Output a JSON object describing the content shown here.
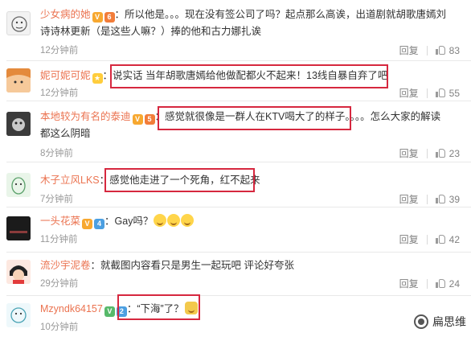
{
  "comments": [
    {
      "user": "少女病的她",
      "text": "：所以他是。。。现在没有签公司了吗？起点那么高诶，出道剧就胡歌唐嫣刘诗诗林更新（是这些人嘛？）捧的他和古力娜扎诶",
      "time": "12分钟前",
      "reply": "回复",
      "likes": "83"
    },
    {
      "user": "妮可妮可妮",
      "text": "：说实话 当年胡歌唐嫣给他做配都火不起来！13线自暴自弃了吧",
      "time": "12分钟前",
      "reply": "回复",
      "likes": "55"
    },
    {
      "user": "本地较为有名的泰迪",
      "text": "：感觉就很像是一群人在KTV喝大了的样子。。。。怎么大家的解读都这么阴暗",
      "time": "8分钟前",
      "reply": "回复",
      "likes": "23"
    },
    {
      "user": "木子立风LKS",
      "text": "：感觉他走进了一个死角，红不起来",
      "time": "7分钟前",
      "reply": "回复",
      "likes": "39"
    },
    {
      "user": "一头花菜",
      "text": "：Gay吗？",
      "time": "11分钟前",
      "reply": "回复",
      "likes": "42"
    },
    {
      "user": "流沙宇泥卷",
      "text": "：就截图内容看只是男生一起玩吧 评论好夸张",
      "time": "29分钟前",
      "reply": "回复",
      "likes": "24"
    },
    {
      "user": "Mzyndk64157",
      "text": "：“下海”了？",
      "time": "10分钟前",
      "reply": "回复",
      "likes": ""
    }
  ],
  "watermark": "扁思维",
  "colors": {
    "username": "#eb7350",
    "highlight_box": "#d6283f",
    "time": "#999999"
  },
  "icons": [
    "avatar",
    "vip-badge-icon",
    "level-badge-icon",
    "thumb-up-icon",
    "emoji-icon",
    "wechat-icon"
  ]
}
